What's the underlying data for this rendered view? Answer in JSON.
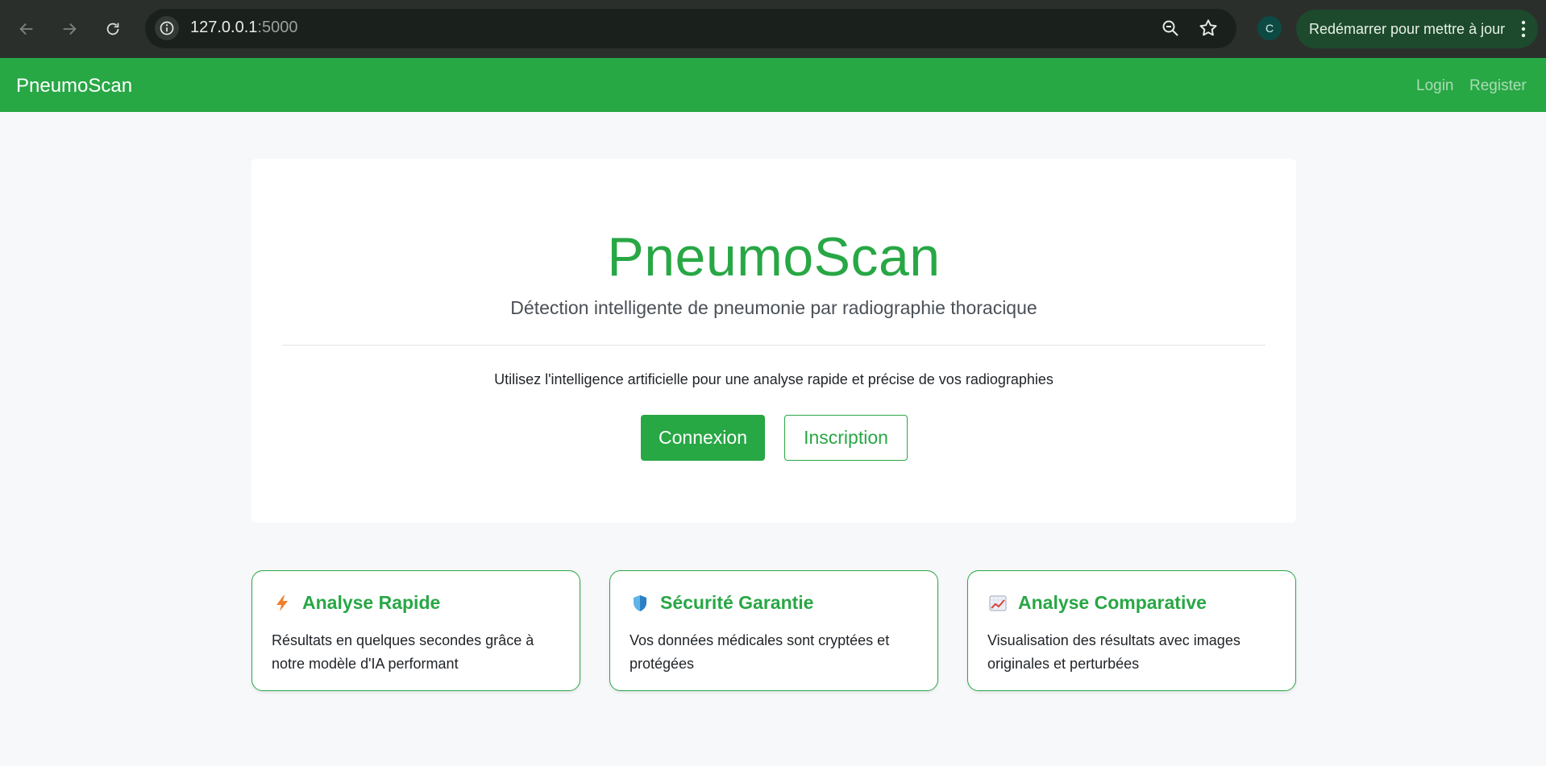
{
  "browser": {
    "url_host": "127.0.0.1",
    "url_port": ":5000",
    "profile_initial": "C",
    "update_label": "Redémarrer pour mettre à jour"
  },
  "navbar": {
    "brand": "PneumoScan",
    "links": [
      {
        "label": "Login"
      },
      {
        "label": "Register"
      }
    ]
  },
  "hero": {
    "title": "PneumoScan",
    "subtitle": "Détection intelligente de pneumonie par radiographie thoracique",
    "lead": "Utilisez l'intelligence artificielle pour une analyse rapide et précise de vos radiographies",
    "primary_button": "Connexion",
    "secondary_button": "Inscription"
  },
  "features": [
    {
      "icon": "lightning-icon",
      "title": "Analyse Rapide",
      "text": "Résultats en quelques secondes grâce à notre modèle d'IA performant"
    },
    {
      "icon": "shield-icon",
      "title": "Sécurité Garantie",
      "text": "Vos données médicales sont cryptées et protégées"
    },
    {
      "icon": "chart-icon",
      "title": "Analyse Comparative",
      "text": "Visualisation des résultats avec images originales et perturbées"
    }
  ],
  "colors": {
    "brand_green": "#28a745",
    "chrome_dark": "#2a2f2c",
    "page_bg": "#f7f8fa"
  }
}
